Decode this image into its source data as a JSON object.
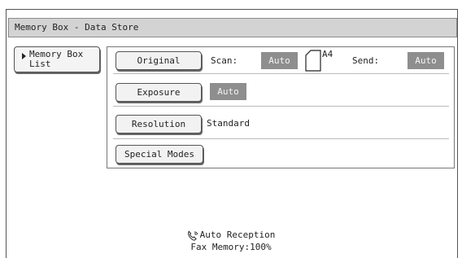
{
  "title_bar": {
    "text": "Memory Box - Data Store"
  },
  "memory_box_button": {
    "label": "Memory Box\nList"
  },
  "rows": {
    "original": {
      "button_label": "Original",
      "scan_label": "Scan:",
      "scan_value": "Auto",
      "paper_size": "A4",
      "send_label": "Send:",
      "send_value": "Auto"
    },
    "exposure": {
      "button_label": "Exposure",
      "value": "Auto"
    },
    "resolution": {
      "button_label": "Resolution",
      "value": "Standard"
    },
    "special_modes": {
      "button_label": "Special Modes"
    }
  },
  "status": {
    "reception": "Auto Reception",
    "fax_memory": "Fax Memory:100%",
    "icon": "phone-icon"
  },
  "colors": {
    "title_bar_bg": "#d3d3d3",
    "chip_bg": "#8e8e8e",
    "button_bg": "#f2f2f2"
  }
}
